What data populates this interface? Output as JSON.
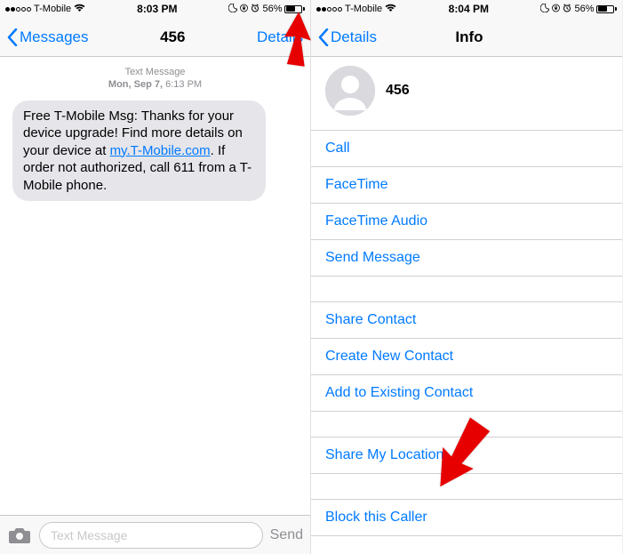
{
  "left": {
    "status": {
      "carrier": "T-Mobile",
      "time": "8:03 PM",
      "battery_pct": "56%"
    },
    "nav": {
      "back": "Messages",
      "title": "456",
      "right": "Details"
    },
    "msg_meta": {
      "type": "Text Message",
      "date_prefix": "Mon, Sep 7,",
      "date_time": "6:13 PM"
    },
    "bubble_parts": {
      "before": "Free T-Mobile Msg: Thanks for your device upgrade! Find more details on your device at ",
      "link": "my.T-Mobile.com",
      "after": ". If order not authorized, call 611 from a T-Mobile phone."
    },
    "compose": {
      "placeholder": "Text Message",
      "send": "Send"
    }
  },
  "right": {
    "status": {
      "carrier": "T-Mobile",
      "time": "8:04 PM",
      "battery_pct": "56%"
    },
    "nav": {
      "back": "Details",
      "title": "Info"
    },
    "contact_name": "456",
    "actions1": [
      "Call",
      "FaceTime",
      "FaceTime Audio",
      "Send Message"
    ],
    "actions2": [
      "Share Contact",
      "Create New Contact",
      "Add to Existing Contact"
    ],
    "actions3": [
      "Share My Location"
    ],
    "actions4": [
      "Block this Caller"
    ]
  }
}
